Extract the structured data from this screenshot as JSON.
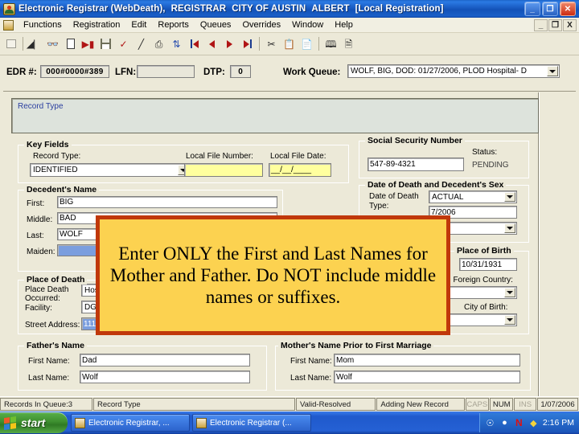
{
  "titlebar": {
    "app": "Electronic Registrar (WebDeath),",
    "role": "REGISTRAR",
    "org": "CITY OF AUSTIN",
    "user": "ALBERT",
    "context": "[Local Registration]",
    "minimize": "_",
    "restore": "❐",
    "close": "✕"
  },
  "menubar": {
    "items": [
      "Functions",
      "Registration",
      "Edit",
      "Reports",
      "Queues",
      "Overrides",
      "Window",
      "Help"
    ],
    "mdi": {
      "minimize": "_",
      "restore": "❐",
      "close": "X"
    }
  },
  "toolbar": {
    "icons": [
      "tile-windows-icon",
      "exit-door-icon",
      "find-binoculars-icon",
      "new-document-icon",
      "open-record-icon",
      "save-disk-icon",
      "spell-check-icon",
      "edit-pencil-icon",
      "print-icon",
      "refresh-icon",
      "first-record-icon",
      "previous-record-icon",
      "next-record-icon",
      "last-record-icon",
      "cut-icon",
      "copy-icon",
      "paste-icon",
      "book-icon",
      "report-icon"
    ]
  },
  "edr_row": {
    "edr_label": "EDR #:",
    "edr_value": "000#0000#389",
    "lfn_label": "LFN:",
    "lfn_value": "",
    "dtp_label": "DTP:",
    "dtp_value": "0",
    "work_queue_label": "Work Queue:",
    "work_queue_value": "WOLF, BIG, DOD: 01/27/2006, PLOD  Hospital- D"
  },
  "record_type_panel": {
    "label": "Record Type"
  },
  "key_fields": {
    "title": "Key Fields",
    "record_type_label": "Record Type:",
    "record_type_value": "IDENTIFIED",
    "local_file_number_label": "Local File Number:",
    "local_file_number_value": "",
    "local_file_date_label": "Local File Date:",
    "local_file_date_value": "__/__/____"
  },
  "ssn": {
    "title": "Social Security Number",
    "value": "547-89-4321",
    "status_label": "Status:",
    "status_value": "PENDING"
  },
  "decedent_name": {
    "title": "Decedent's Name",
    "first_label": "First:",
    "first_value": "BIG",
    "middle_label": "Middle:",
    "middle_value": "BAD",
    "last_label": "Last:",
    "last_value": "WOLF",
    "maiden_label": "Maiden:",
    "maiden_value": ""
  },
  "dod_sex": {
    "title": "Date of Death and Decedent's Sex",
    "dod_type_label_1": "Date of Death",
    "dod_type_label_2": "Type:",
    "dod_type_value": "ACTUAL",
    "dod_value": "7/2006",
    "sex_value": ""
  },
  "place_of_death": {
    "title": "Place of Death",
    "plod_label_1": "Place Death",
    "plod_label_2": "Occurred:",
    "plod_value": "Hosp",
    "facility_label": "Facility:",
    "facility_value": "DGH",
    "street_label": "Street Address:",
    "street_value": "111"
  },
  "place_of_birth": {
    "title": "Place of Birth",
    "dob_value": "10/31/1931",
    "foreign_country_label": "re: Foreign Country:",
    "foreign_country_value": "",
    "city_of_birth_label": "City of Birth:",
    "city_of_birth_value": ""
  },
  "fathers_name": {
    "title": "Father's Name",
    "first_label": "First Name:",
    "first_value": "Dad",
    "last_label": "Last Name:",
    "last_value": "Wolf"
  },
  "mothers_name": {
    "title": "Mother's Name Prior to First Marriage",
    "first_label": "First Name:",
    "first_value": "Mom",
    "last_label": "Last Name:",
    "last_value": "Wolf"
  },
  "callout": {
    "text": "Enter ONLY the First and Last Names for Mother and Father.  Do NOT include middle names or suffixes.",
    "fill_color": "#fcd250",
    "border_color": "#c0380b"
  },
  "statusbar": {
    "records_in_queue": "Records In Queue:3",
    "record_type": "Record Type",
    "validation": "Valid-Resolved",
    "mode": "Adding New Record",
    "caps": "CAPS",
    "num": "NUM",
    "ins": "INS",
    "date": "1/07/2006"
  },
  "taskbar": {
    "start": "start",
    "buttons": [
      "Electronic Registrar, ...",
      "Electronic Registrar (..."
    ],
    "tray_icons": [
      "mouse-pointer-icon",
      "network-icon",
      "norton-n-icon",
      "shield-icon"
    ],
    "clock": "2:16 PM"
  }
}
